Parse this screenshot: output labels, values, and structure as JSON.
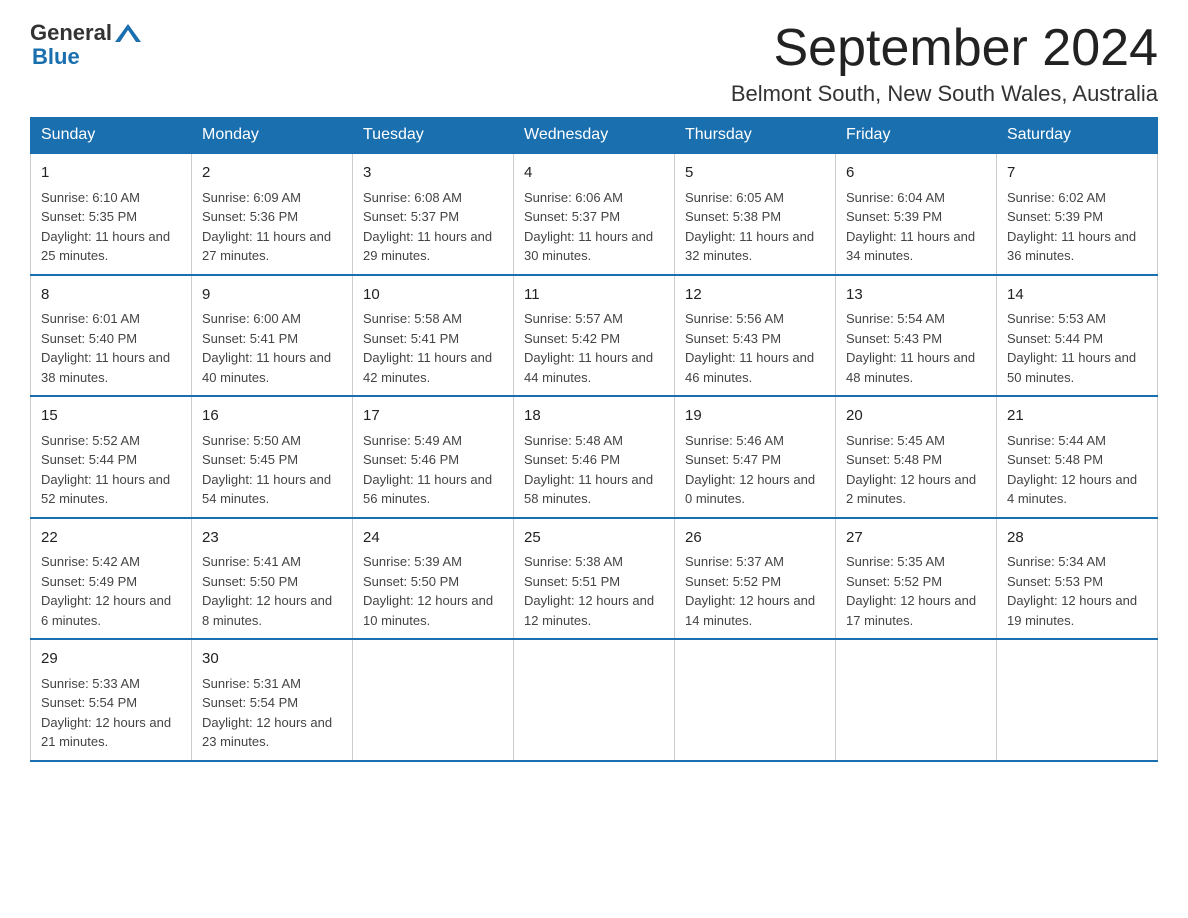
{
  "header": {
    "logo_general": "General",
    "logo_blue": "Blue",
    "month_title": "September 2024",
    "location": "Belmont South, New South Wales, Australia"
  },
  "weekdays": [
    "Sunday",
    "Monday",
    "Tuesday",
    "Wednesday",
    "Thursday",
    "Friday",
    "Saturday"
  ],
  "weeks": [
    [
      {
        "day": "1",
        "sunrise": "6:10 AM",
        "sunset": "5:35 PM",
        "daylight": "11 hours and 25 minutes."
      },
      {
        "day": "2",
        "sunrise": "6:09 AM",
        "sunset": "5:36 PM",
        "daylight": "11 hours and 27 minutes."
      },
      {
        "day": "3",
        "sunrise": "6:08 AM",
        "sunset": "5:37 PM",
        "daylight": "11 hours and 29 minutes."
      },
      {
        "day": "4",
        "sunrise": "6:06 AM",
        "sunset": "5:37 PM",
        "daylight": "11 hours and 30 minutes."
      },
      {
        "day": "5",
        "sunrise": "6:05 AM",
        "sunset": "5:38 PM",
        "daylight": "11 hours and 32 minutes."
      },
      {
        "day": "6",
        "sunrise": "6:04 AM",
        "sunset": "5:39 PM",
        "daylight": "11 hours and 34 minutes."
      },
      {
        "day": "7",
        "sunrise": "6:02 AM",
        "sunset": "5:39 PM",
        "daylight": "11 hours and 36 minutes."
      }
    ],
    [
      {
        "day": "8",
        "sunrise": "6:01 AM",
        "sunset": "5:40 PM",
        "daylight": "11 hours and 38 minutes."
      },
      {
        "day": "9",
        "sunrise": "6:00 AM",
        "sunset": "5:41 PM",
        "daylight": "11 hours and 40 minutes."
      },
      {
        "day": "10",
        "sunrise": "5:58 AM",
        "sunset": "5:41 PM",
        "daylight": "11 hours and 42 minutes."
      },
      {
        "day": "11",
        "sunrise": "5:57 AM",
        "sunset": "5:42 PM",
        "daylight": "11 hours and 44 minutes."
      },
      {
        "day": "12",
        "sunrise": "5:56 AM",
        "sunset": "5:43 PM",
        "daylight": "11 hours and 46 minutes."
      },
      {
        "day": "13",
        "sunrise": "5:54 AM",
        "sunset": "5:43 PM",
        "daylight": "11 hours and 48 minutes."
      },
      {
        "day": "14",
        "sunrise": "5:53 AM",
        "sunset": "5:44 PM",
        "daylight": "11 hours and 50 minutes."
      }
    ],
    [
      {
        "day": "15",
        "sunrise": "5:52 AM",
        "sunset": "5:44 PM",
        "daylight": "11 hours and 52 minutes."
      },
      {
        "day": "16",
        "sunrise": "5:50 AM",
        "sunset": "5:45 PM",
        "daylight": "11 hours and 54 minutes."
      },
      {
        "day": "17",
        "sunrise": "5:49 AM",
        "sunset": "5:46 PM",
        "daylight": "11 hours and 56 minutes."
      },
      {
        "day": "18",
        "sunrise": "5:48 AM",
        "sunset": "5:46 PM",
        "daylight": "11 hours and 58 minutes."
      },
      {
        "day": "19",
        "sunrise": "5:46 AM",
        "sunset": "5:47 PM",
        "daylight": "12 hours and 0 minutes."
      },
      {
        "day": "20",
        "sunrise": "5:45 AM",
        "sunset": "5:48 PM",
        "daylight": "12 hours and 2 minutes."
      },
      {
        "day": "21",
        "sunrise": "5:44 AM",
        "sunset": "5:48 PM",
        "daylight": "12 hours and 4 minutes."
      }
    ],
    [
      {
        "day": "22",
        "sunrise": "5:42 AM",
        "sunset": "5:49 PM",
        "daylight": "12 hours and 6 minutes."
      },
      {
        "day": "23",
        "sunrise": "5:41 AM",
        "sunset": "5:50 PM",
        "daylight": "12 hours and 8 minutes."
      },
      {
        "day": "24",
        "sunrise": "5:39 AM",
        "sunset": "5:50 PM",
        "daylight": "12 hours and 10 minutes."
      },
      {
        "day": "25",
        "sunrise": "5:38 AM",
        "sunset": "5:51 PM",
        "daylight": "12 hours and 12 minutes."
      },
      {
        "day": "26",
        "sunrise": "5:37 AM",
        "sunset": "5:52 PM",
        "daylight": "12 hours and 14 minutes."
      },
      {
        "day": "27",
        "sunrise": "5:35 AM",
        "sunset": "5:52 PM",
        "daylight": "12 hours and 17 minutes."
      },
      {
        "day": "28",
        "sunrise": "5:34 AM",
        "sunset": "5:53 PM",
        "daylight": "12 hours and 19 minutes."
      }
    ],
    [
      {
        "day": "29",
        "sunrise": "5:33 AM",
        "sunset": "5:54 PM",
        "daylight": "12 hours and 21 minutes."
      },
      {
        "day": "30",
        "sunrise": "5:31 AM",
        "sunset": "5:54 PM",
        "daylight": "12 hours and 23 minutes."
      },
      null,
      null,
      null,
      null,
      null
    ]
  ],
  "labels": {
    "sunrise_prefix": "Sunrise: ",
    "sunset_prefix": "Sunset: ",
    "daylight_prefix": "Daylight: "
  }
}
